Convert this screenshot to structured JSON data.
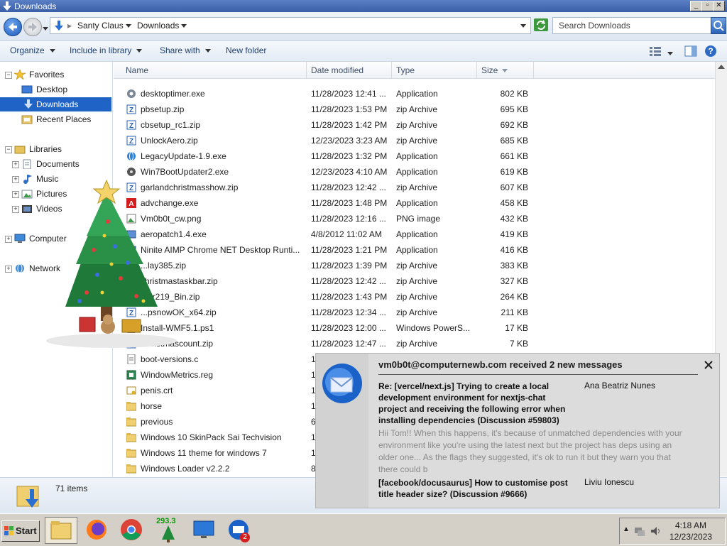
{
  "window": {
    "title": "Downloads"
  },
  "address": {
    "crumbs": [
      "Santy Claus",
      "Downloads"
    ],
    "search_placeholder": "Search Downloads"
  },
  "toolbar": {
    "organize": "Organize",
    "include": "Include in library",
    "share": "Share with",
    "new_folder": "New folder"
  },
  "nav": {
    "favorites": "Favorites",
    "desktop": "Desktop",
    "downloads": "Downloads",
    "recent": "Recent Places",
    "libraries": "Libraries",
    "documents": "Documents",
    "music": "Music",
    "pictures": "Pictures",
    "videos": "Videos",
    "computer": "Computer",
    "network": "Network"
  },
  "columns": {
    "name": "Name",
    "date": "Date modified",
    "type": "Type",
    "size": "Size"
  },
  "files": [
    {
      "name": "desktoptimer.exe",
      "date": "11/28/2023 12:41 ...",
      "type": "Application",
      "size": "802 KB",
      "icon": "gear"
    },
    {
      "name": "pbsetup.zip",
      "date": "11/28/2023 1:53 PM",
      "type": "zip Archive",
      "size": "695 KB",
      "icon": "zip"
    },
    {
      "name": "cbsetup_rc1.zip",
      "date": "11/28/2023 1:42 PM",
      "type": "zip Archive",
      "size": "692 KB",
      "icon": "zip"
    },
    {
      "name": "UnlockAero.zip",
      "date": "12/23/2023 3:23 AM",
      "type": "zip Archive",
      "size": "685 KB",
      "icon": "zip"
    },
    {
      "name": "LegacyUpdate-1.9.exe",
      "date": "11/28/2023 1:32 PM",
      "type": "Application",
      "size": "661 KB",
      "icon": "globe"
    },
    {
      "name": "Win7BootUpdater2.exe",
      "date": "12/23/2023 4:10 AM",
      "type": "Application",
      "size": "619 KB",
      "icon": "disk"
    },
    {
      "name": "garlandchristmasshow.zip",
      "date": "11/28/2023 12:42 ...",
      "type": "zip Archive",
      "size": "607 KB",
      "icon": "zip"
    },
    {
      "name": "advchange.exe",
      "date": "11/28/2023 1:48 PM",
      "type": "Application",
      "size": "458 KB",
      "icon": "red"
    },
    {
      "name": "Vm0b0t_cw.png",
      "date": "11/28/2023 12:16 ...",
      "type": "PNG image",
      "size": "432 KB",
      "icon": "image"
    },
    {
      "name": "aeropatch1.4.exe",
      "date": "4/8/2012 11:02 AM",
      "type": "Application",
      "size": "419 KB",
      "icon": "app"
    },
    {
      "name": "Ninite AIMP Chrome NET Desktop Runti...",
      "date": "11/28/2023 1:21 PM",
      "type": "Application",
      "size": "416 KB",
      "icon": "app"
    },
    {
      "name": "...lay385.zip",
      "date": "11/28/2023 1:39 PM",
      "type": "zip Archive",
      "size": "383 KB",
      "icon": "zip"
    },
    {
      "name": "christmastaskbar.zip",
      "date": "11/28/2023 12:42 ...",
      "type": "zip Archive",
      "size": "327 KB",
      "icon": "zip"
    },
    {
      "name": "...er219_Bin.zip",
      "date": "11/28/2023 1:43 PM",
      "type": "zip Archive",
      "size": "264 KB",
      "icon": "zip"
    },
    {
      "name": "...psnowOK_x64.zip",
      "date": "11/28/2023 12:34 ...",
      "type": "zip Archive",
      "size": "211 KB",
      "icon": "zip"
    },
    {
      "name": "Install-WMF5.1.ps1",
      "date": "11/28/2023 12:00 ...",
      "type": "Windows PowerS...",
      "size": "17 KB",
      "icon": "doc"
    },
    {
      "name": "Christmascount.zip",
      "date": "11/28/2023 12:47 ...",
      "type": "zip Archive",
      "size": "7 KB",
      "icon": "zip"
    },
    {
      "name": "boot-versions.c",
      "date": "1",
      "type": "",
      "size": "",
      "icon": "doc"
    },
    {
      "name": "WindowMetrics.reg",
      "date": "1",
      "type": "",
      "size": "",
      "icon": "reg"
    },
    {
      "name": "penis.crt",
      "date": "1",
      "type": "",
      "size": "",
      "icon": "cert"
    },
    {
      "name": "horse",
      "date": "1",
      "type": "",
      "size": "",
      "icon": "folder"
    },
    {
      "name": "previous",
      "date": "6",
      "type": "",
      "size": "",
      "icon": "folder"
    },
    {
      "name": "Windows 10 SkinPack Sai Techvision",
      "date": "1",
      "type": "",
      "size": "",
      "icon": "folder"
    },
    {
      "name": "Windows 11 theme for windows 7",
      "date": "1",
      "type": "",
      "size": "",
      "icon": "folder"
    },
    {
      "name": "Windows Loader v2.2.2",
      "date": "8",
      "type": "",
      "size": "",
      "icon": "folder"
    }
  ],
  "status": {
    "count": "71 items"
  },
  "notification": {
    "header": "vm0b0t@computernewb.com received 2 new messages",
    "messages": [
      {
        "subject": "Re: [vercel/next.js] Trying to create a local development environment for nextjs-chat project and receiving the following error when installing dependencies (Discussion #59803)",
        "from": "Ana Beatriz Nunes",
        "preview": "Hii Tom!! When this happens, it's because of unmatched dependencies with your environment like you're using the latest next but the project has deps using an older one... As the flags they suggested, it's ok to run it but they warn you that there could b"
      },
      {
        "subject": "[facebook/docusaurus] How to customise post title header size? (Discussion #9666)",
        "from": "Liviu Ionescu"
      }
    ]
  },
  "taskbar": {
    "start": "Start",
    "gadget_counter": "293.3",
    "badge": "2",
    "clock_time": "4:18 AM",
    "clock_date": "12/23/2023"
  }
}
